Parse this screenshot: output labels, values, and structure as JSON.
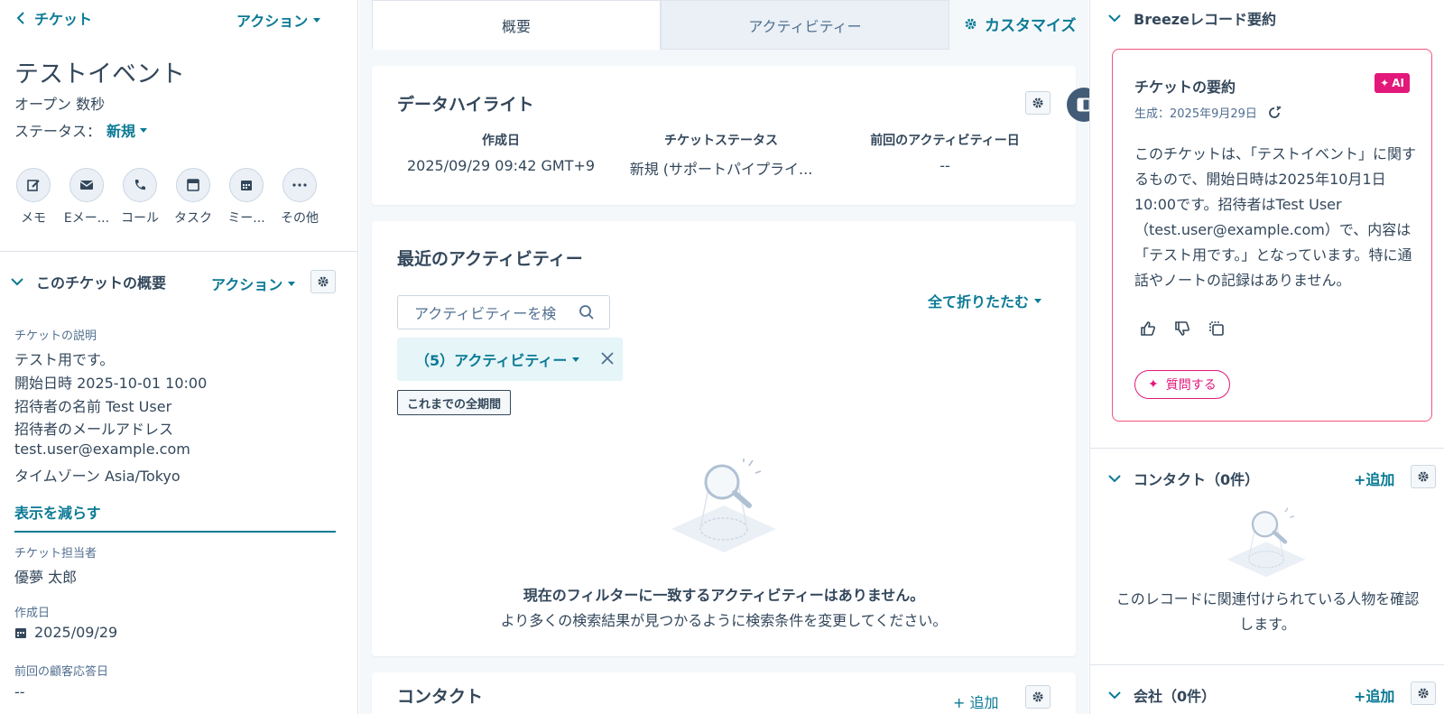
{
  "left": {
    "back_label": "チケット",
    "actions_label": "アクション",
    "title": "テストイベント",
    "open_text": "オープン 数秒",
    "status_label": "ステータス：",
    "status_value": "新規",
    "activity_buttons": [
      {
        "label": "メモ",
        "icon": "edit-icon"
      },
      {
        "label": "Eメー...",
        "icon": "email-icon"
      },
      {
        "label": "コール",
        "icon": "phone-icon"
      },
      {
        "label": "タスク",
        "icon": "task-icon"
      },
      {
        "label": "ミー...",
        "icon": "calendar-icon"
      },
      {
        "label": "その他",
        "icon": "more-icon"
      }
    ],
    "section_title": "このチケットの概要",
    "section_actions": "アクション",
    "description_label": "チケットの説明",
    "description_lines": [
      "テスト用です。",
      "開始日時  2025-10-01 10:00",
      "招待者の名前   Test User",
      "招待者のメールアドレス",
      "test.user@example.com",
      "タイムゾーン    Asia/Tokyo"
    ],
    "show_less": "表示を減らす",
    "owner_label": "チケット担当者",
    "owner_value": "優夢 太郎",
    "created_label": "作成日",
    "created_value": "2025/09/29",
    "last_reply_label": "前回の顧客応答日",
    "last_reply_value": "--"
  },
  "middle": {
    "tabs": [
      "概要",
      "アクティビティー"
    ],
    "customize": "カスタマイズ",
    "highlights": {
      "title": "データハイライト",
      "columns": [
        {
          "header": "作成日",
          "value": "2025/09/29 09:42 GMT+9"
        },
        {
          "header": "チケットステータス",
          "value": "新規 (サポートパイプライ..."
        },
        {
          "header": "前回のアクティビティー日",
          "value": "--"
        }
      ]
    },
    "recent": {
      "title": "最近のアクティビティー",
      "search_placeholder": "アクティビティーを検",
      "collapse_all": "全て折りたたむ",
      "filter_chip": "（5）アクティビティー",
      "period": "これまでの全期間",
      "empty_title": "現在のフィルターに一致するアクティビティーはありません。",
      "empty_sub": "より多くの検索結果が見つかるように検索条件を変更してください。"
    },
    "contacts": {
      "title": "コンタクト",
      "add": "+ 追加"
    }
  },
  "right": {
    "breeze_title": "Breezeレコード要約",
    "ai_title": "チケットの要約",
    "ai_badge": "AI",
    "generated": "生成：2025年9月29日",
    "summary": "このチケットは、「テストイベント」に関するもので、開始日時は2025年10月1日10:00です。招待者はTest User（test.user@example.com）で、内容は「テスト用です。」となっています。特に通話やノートの記録はありません。",
    "ask_button": "質問する",
    "contacts_title": "コンタクト（0件）",
    "contacts_add": "+追加",
    "contacts_empty": "このレコードに関連付けられている人物を確認します。",
    "company_title": "会社（0件）",
    "company_add": "+追加"
  },
  "colors": {
    "accent": "#0b7a95",
    "text": "#33475b",
    "ai_pink": "#e2187a"
  }
}
